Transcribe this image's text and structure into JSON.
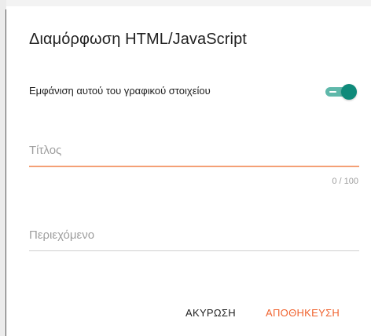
{
  "dialog": {
    "title": "Διαμόρφωση HTML/JavaScript"
  },
  "toggle": {
    "label": "Εμφάνιση αυτού του γραφικού στοιχείου",
    "checked": true
  },
  "title_field": {
    "placeholder": "Τίτλος",
    "value": "",
    "counter": "0 / 100"
  },
  "content_field": {
    "placeholder": "Περιεχόμενο",
    "value": ""
  },
  "actions": {
    "cancel_label": "ΑΚΥΡΩΣΗ",
    "save_label": "ΑΠΟΘΗΚΕΥΣΗ"
  },
  "colors": {
    "accent": "#f0632f",
    "toggle_on": "#0f8a7a",
    "toggle_track": "#5fb8aa"
  }
}
